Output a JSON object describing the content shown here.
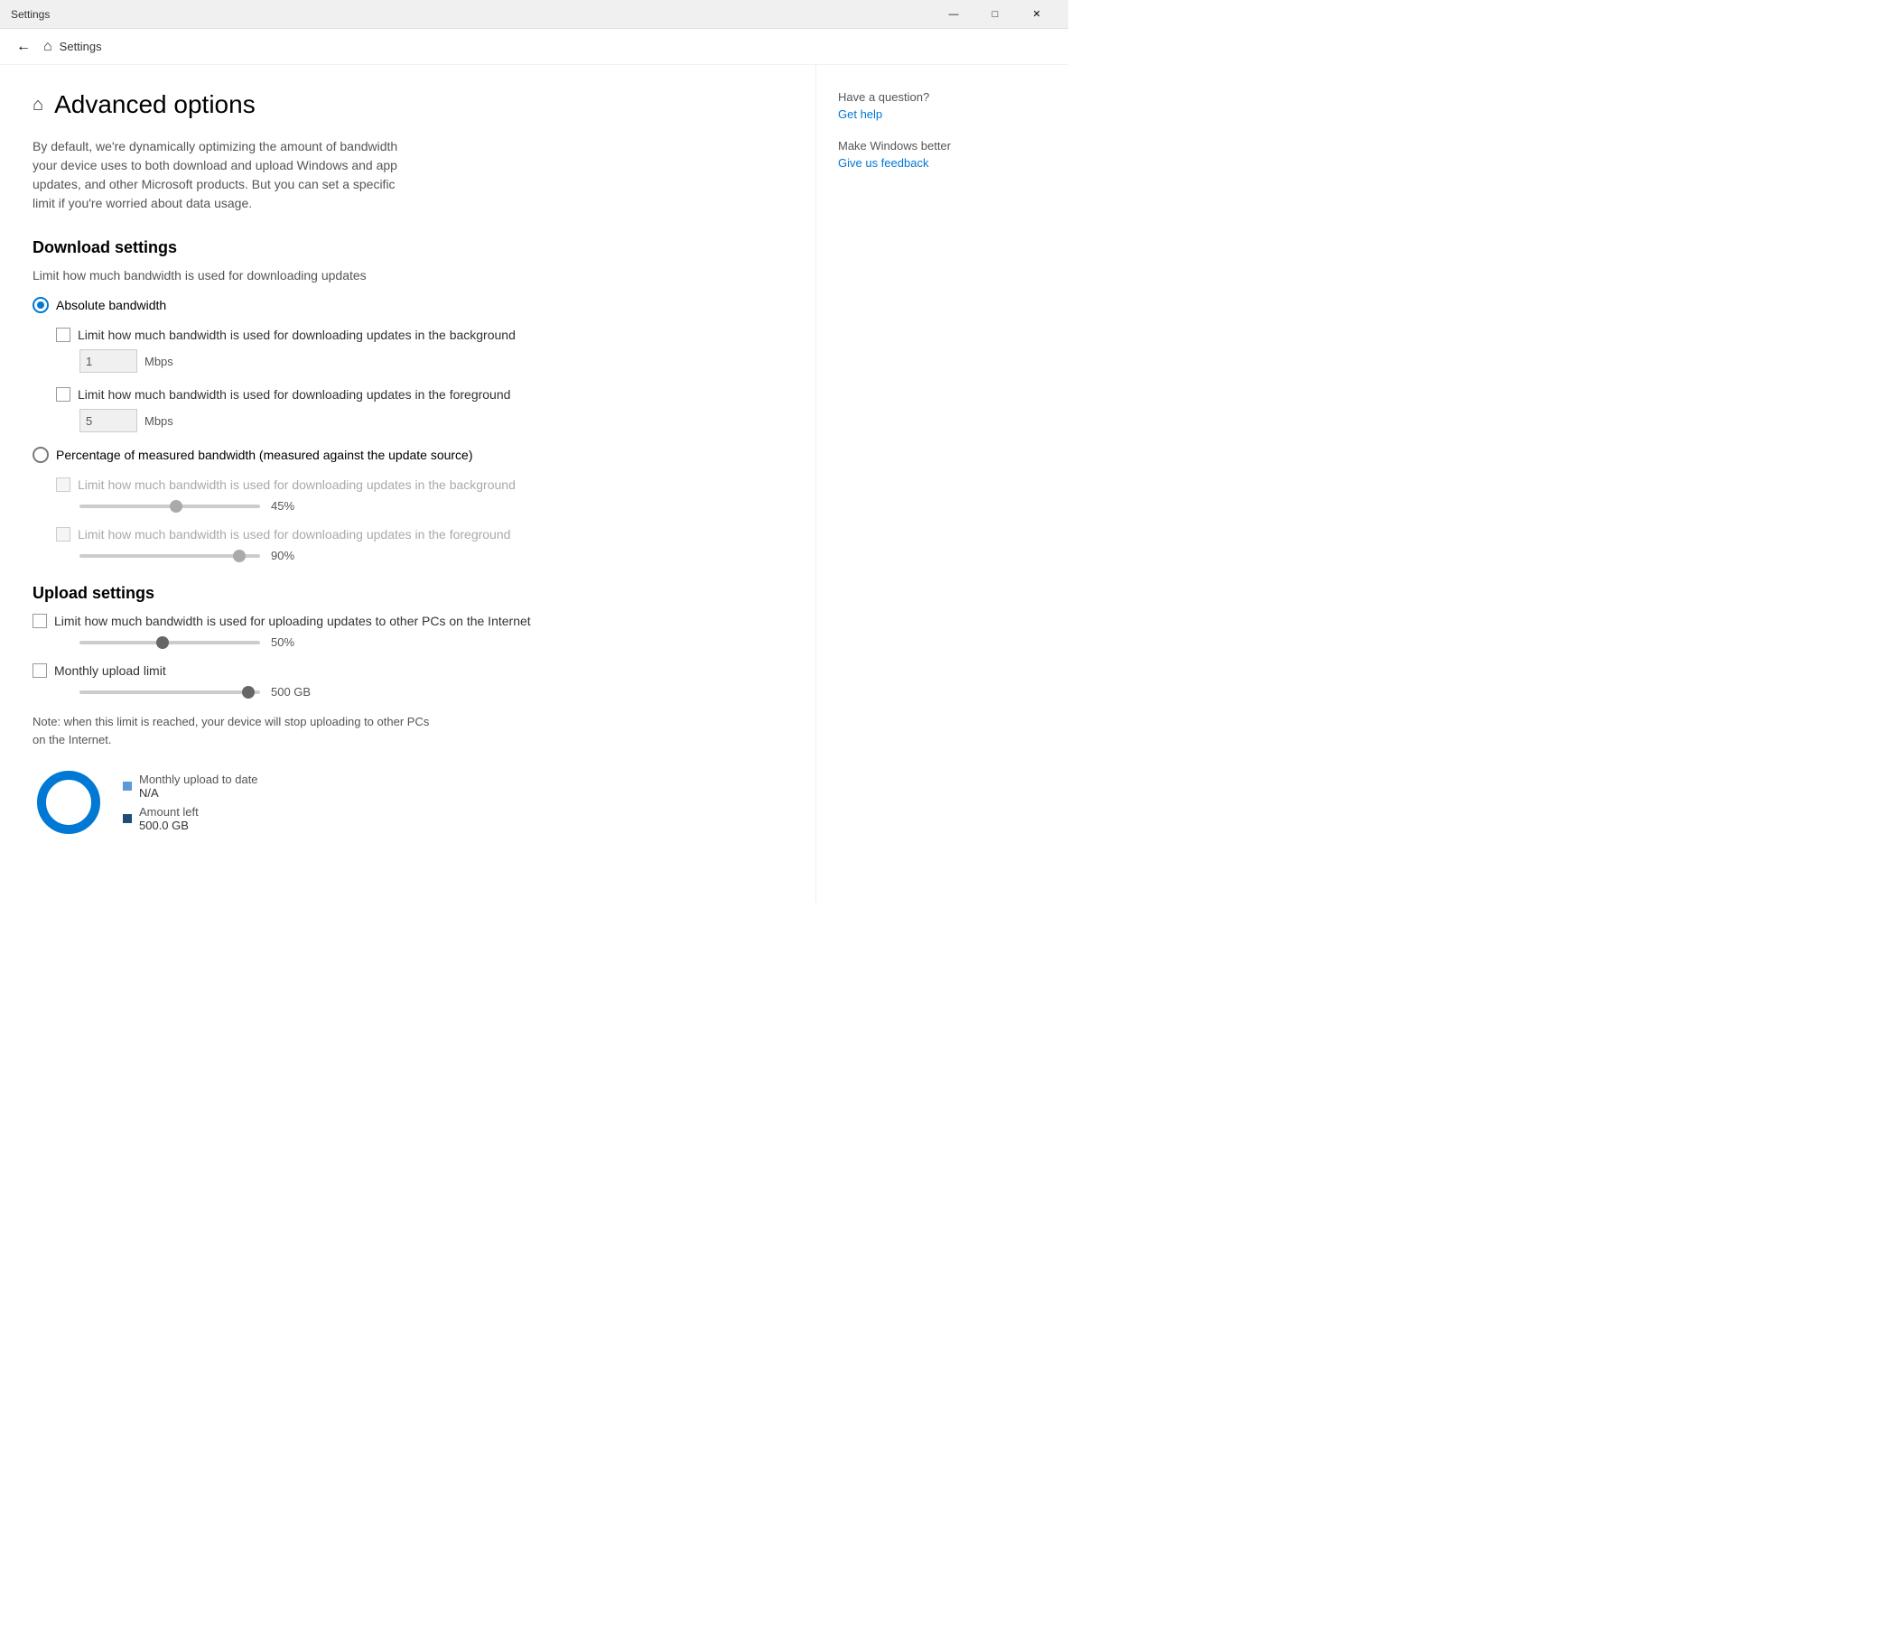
{
  "titlebar": {
    "title": "Settings",
    "minimize": "—",
    "maximize": "□",
    "close": "✕"
  },
  "navbar": {
    "back_label": "←",
    "home_label": "⌂",
    "title": "Settings"
  },
  "page": {
    "home_icon": "⌂",
    "title": "Advanced options",
    "description": "By default, we're dynamically optimizing the amount of bandwidth your device uses to both download and upload Windows and app updates, and other Microsoft products. But you can set a specific limit if you're worried about data usage."
  },
  "download_settings": {
    "heading": "Download settings",
    "label": "Limit how much bandwidth is used for downloading updates",
    "radio_absolute_label": "Absolute bandwidth",
    "radio_absolute_checked": true,
    "checkbox_background_label": "Limit how much bandwidth is used for downloading updates in the background",
    "checkbox_background_checked": false,
    "background_value": "1",
    "background_unit": "Mbps",
    "checkbox_foreground_label": "Limit how much bandwidth is used for downloading updates in the foreground",
    "checkbox_foreground_checked": false,
    "foreground_value": "5",
    "foreground_unit": "Mbps",
    "radio_percentage_label": "Percentage of measured bandwidth (measured against the update source)",
    "radio_percentage_checked": false,
    "pct_background_label": "Limit how much bandwidth is used for downloading updates in the background",
    "pct_background_checked": false,
    "pct_background_value": "45%",
    "pct_background_slider_pos": "55",
    "pct_foreground_label": "Limit how much bandwidth is used for downloading updates in the foreground",
    "pct_foreground_checked": false,
    "pct_foreground_value": "90%",
    "pct_foreground_slider_pos": "90"
  },
  "upload_settings": {
    "heading": "Upload settings",
    "checkbox_upload_label": "Limit how much bandwidth is used for uploading updates to other PCs on the Internet",
    "checkbox_upload_checked": false,
    "upload_value": "50%",
    "upload_slider_pos": "45",
    "checkbox_monthly_label": "Monthly upload limit",
    "checkbox_monthly_checked": false,
    "monthly_value": "500 GB",
    "monthly_slider_pos": "90",
    "note": "Note: when this limit is reached, your device will stop uploading to other PCs on the Internet.",
    "chart_legend_monthly_label": "Monthly upload to date",
    "chart_legend_monthly_value": "N/A",
    "chart_legend_amount_label": "Amount left",
    "chart_legend_amount_value": "500.0 GB"
  },
  "sidebar": {
    "question_label": "Have a question?",
    "get_help_label": "Get help",
    "make_better_label": "Make Windows better",
    "feedback_label": "Give us feedback"
  }
}
